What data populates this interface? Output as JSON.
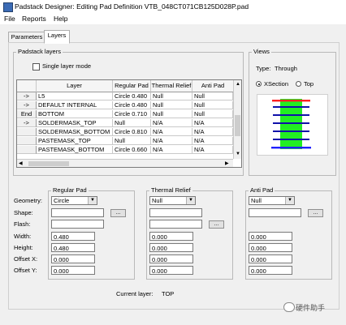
{
  "window": {
    "title": "Padstack Designer: Editing Pad Definition VTB_048CT071CB125D028P.pad"
  },
  "menu": {
    "file": "File",
    "reports": "Reports",
    "help": "Help"
  },
  "tabs": [
    {
      "label": "Parameters"
    },
    {
      "label": "Layers"
    }
  ],
  "padstack_layers": {
    "group_title": "Padstack layers",
    "single_layer_mode_label": "Single layer mode",
    "columns": [
      "Layer",
      "Regular Pad",
      "Thermal Relief",
      "Anti Pad"
    ],
    "rows": [
      {
        "marker": "->",
        "layer": "L5",
        "regular": "Circle 0.480",
        "thermal": "Null",
        "anti": "Null"
      },
      {
        "marker": "->",
        "layer": "DEFAULT INTERNAL",
        "regular": "Circle 0.480",
        "thermal": "Null",
        "anti": "Null"
      },
      {
        "marker": "End",
        "layer": "BOTTOM",
        "regular": "Circle 0.710",
        "thermal": "Null",
        "anti": "Null"
      },
      {
        "marker": "->",
        "layer": "SOLDERMASK_TOP",
        "regular": "Null",
        "thermal": "N/A",
        "anti": "N/A"
      },
      {
        "marker": "",
        "layer": "SOLDERMASK_BOTTOM",
        "regular": "Circle 0.810",
        "thermal": "N/A",
        "anti": "N/A"
      },
      {
        "marker": "",
        "layer": "PASTEMASK_TOP",
        "regular": "Null",
        "thermal": "N/A",
        "anti": "N/A"
      },
      {
        "marker": "",
        "layer": "PASTEMASK_BOTTOM",
        "regular": "Circle 0.660",
        "thermal": "N/A",
        "anti": "N/A"
      }
    ]
  },
  "views": {
    "group_title": "Views",
    "type_label": "Type:",
    "type_value": "Through",
    "xsection_label": "XSection",
    "top_label": "Top",
    "selected": "XSection",
    "colors": {
      "barrel": "#22ee22",
      "pad_top": "#ff2020",
      "pad_inner": "#1010aa",
      "pad_bottom": "#2020ff"
    }
  },
  "labels": {
    "geometry": "Geometry:",
    "shape": "Shape:",
    "flash": "Flash:",
    "width": "Width:",
    "height": "Height:",
    "offset_x": "Offset X:",
    "offset_y": "Offset Y:",
    "browse": "..."
  },
  "regular_pad": {
    "title": "Regular Pad",
    "geometry": "Circle",
    "shape": "",
    "flash": "",
    "width": "0.480",
    "height": "0.480",
    "offset_x": "0.000",
    "offset_y": "0.000"
  },
  "thermal_relief": {
    "title": "Thermal Relief",
    "geometry": "Null",
    "shape": "",
    "flash": "",
    "width": "0.000",
    "height": "0.000",
    "offset_x": "0.000",
    "offset_y": "0.000"
  },
  "anti_pad": {
    "title": "Anti Pad",
    "geometry": "Null",
    "shape": "",
    "width": "0.000",
    "height": "0.000",
    "offset_x": "0.000",
    "offset_y": "0.000"
  },
  "status": {
    "current_layer_label": "Current layer:",
    "current_layer_value": "TOP"
  },
  "watermark": {
    "text": "硬件助手"
  }
}
